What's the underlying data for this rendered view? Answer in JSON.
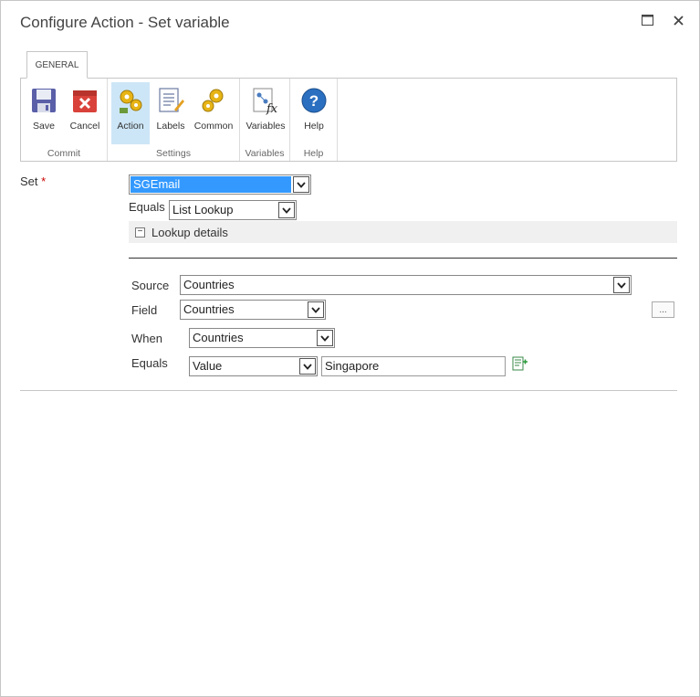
{
  "window": {
    "title": "Configure Action - Set variable"
  },
  "ribbon": {
    "tab_label": "GENERAL",
    "groups": [
      {
        "label": "Commit",
        "buttons": [
          {
            "label": "Save",
            "icon": "save-icon"
          },
          {
            "label": "Cancel",
            "icon": "cancel-icon"
          }
        ]
      },
      {
        "label": "Settings",
        "buttons": [
          {
            "label": "Action",
            "icon": "action-gears-icon",
            "selected": true
          },
          {
            "label": "Labels",
            "icon": "labels-icon"
          },
          {
            "label": "Common",
            "icon": "common-gears-icon"
          }
        ]
      },
      {
        "label": "Variables",
        "buttons": [
          {
            "label": "Variables",
            "icon": "variables-fx-icon"
          }
        ]
      },
      {
        "label": "Help",
        "buttons": [
          {
            "label": "Help",
            "icon": "help-icon"
          }
        ]
      }
    ]
  },
  "form": {
    "set_label": "Set",
    "required_marker": "*",
    "set_value": "SGEmail",
    "equals_label": "Equals",
    "equals_value": "List Lookup",
    "lookup_toggle": "−",
    "lookup_details_label": "Lookup details",
    "source_label": "Source",
    "source_value": "Countries",
    "field_label": "Field",
    "field_value": "Countries",
    "ellipsis_label": "...",
    "when_label": "When",
    "when_value": "Countries",
    "when_equals_label": "Equals",
    "when_equals_type": "Value",
    "when_equals_value": "Singapore"
  },
  "colors": {
    "selection": "#3399ff",
    "ribbon_selected": "#cde6f7",
    "required": "#cc0000"
  }
}
